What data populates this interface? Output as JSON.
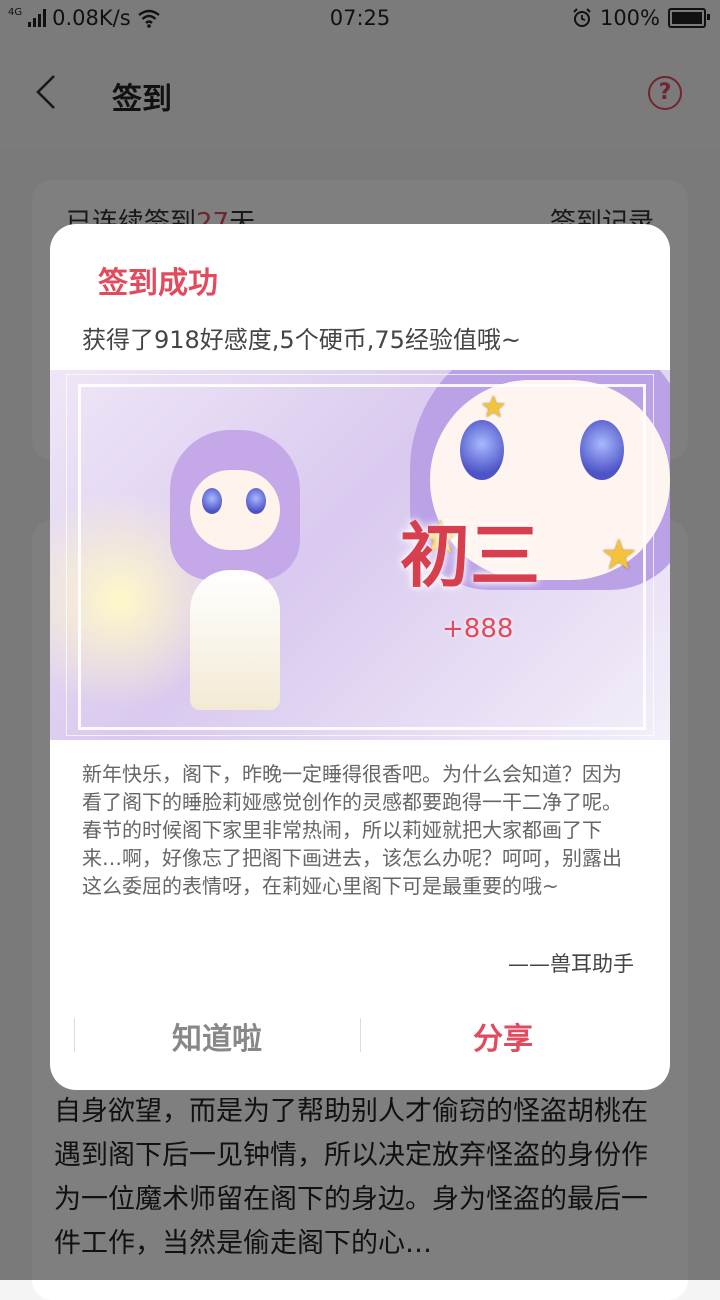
{
  "status_bar": {
    "network": "4G",
    "speed": "0.08K/s",
    "time": "07:25",
    "battery": "100%",
    "battery_level": 1.0
  },
  "header": {
    "title": "签到",
    "help": "?"
  },
  "background": {
    "streak_prefix": "已连续签到",
    "streak_days": "27",
    "streak_suffix": "天",
    "record_link": "签到记录",
    "story_text": "自身欲望，而是为了帮助别人才偷窃的怪盗胡桃在遇到阁下后一见钟情，所以决定放弃怪盗的身份作为一位魔术师留在阁下的身边。身为怪盗的最后一件工作，当然是偷走阁下的心…"
  },
  "dialog": {
    "title": "签到成功",
    "reward": "获得了918好感度,5个硬币,75经验值哦~",
    "banner": {
      "day": "初三",
      "bonus": "+888"
    },
    "message": "新年快乐，阁下，昨晚一定睡得很香吧。为什么会知道？因为看了阁下的睡脸莉娅感觉创作的灵感都要跑得一干二净了呢。春节的时候阁下家里非常热闹，所以莉娅就把大家都画了下来…啊，好像忘了把阁下画进去，该怎么办呢？呵呵，别露出这么委屈的表情呀，在莉娅心里阁下可是最重要的哦~",
    "signature": "——兽耳助手",
    "buttons": {
      "ok": "知道啦",
      "share": "分享"
    }
  },
  "colors": {
    "accent": "#e34a5d",
    "overlay": "rgba(0,0,0,0.5)"
  }
}
